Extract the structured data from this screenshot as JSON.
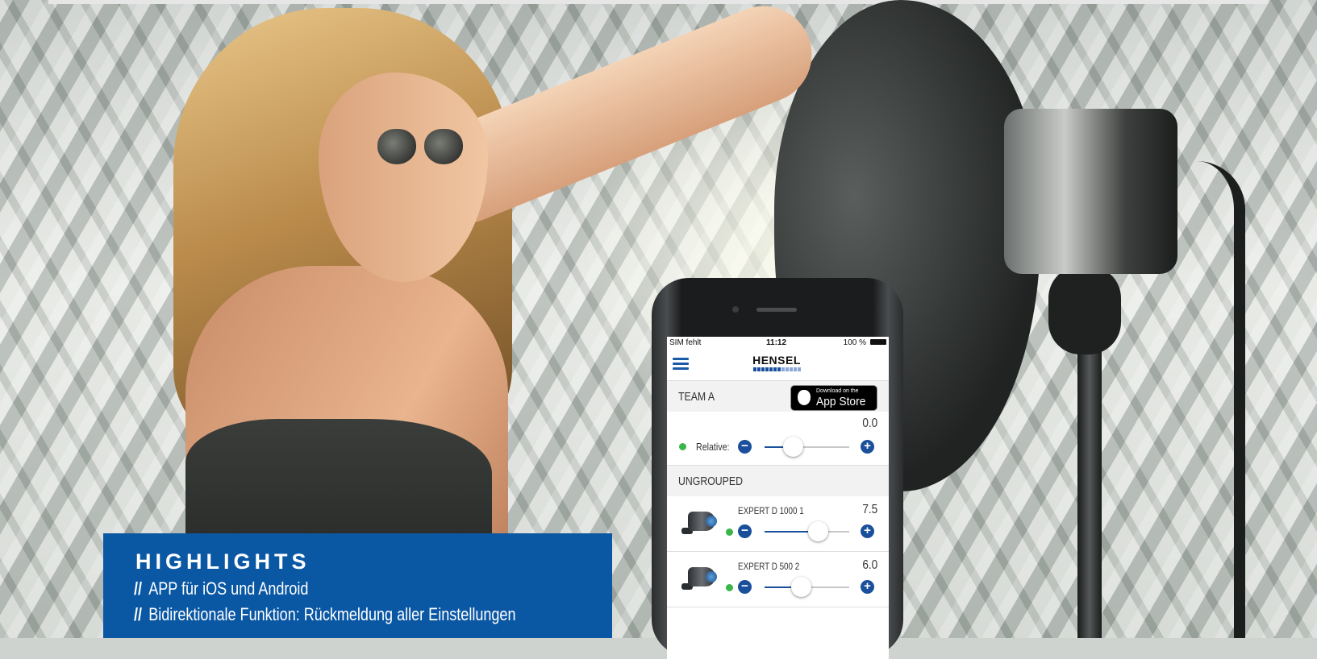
{
  "highlights": {
    "title": "HIGHLIGHTS",
    "items": [
      "APP für iOS und Android",
      "Bidirektionale Funktion: Rückmeldung aller Einstellungen"
    ],
    "bullet": "//",
    "background_color": "#0a57a4"
  },
  "phone": {
    "status_bar": {
      "carrier": "SIM fehlt",
      "time": "11:12",
      "battery": "100 %"
    },
    "header": {
      "brand": "HENSEL",
      "menu_icon": "hamburger-menu-icon"
    },
    "team": {
      "label": "TEAM A",
      "store_badge": {
        "small": "Download on the",
        "big": "App Store",
        "icon": "apple-icon"
      },
      "relative_label": "Relative:",
      "value": "0.0",
      "slider_level": 0.33
    },
    "ungrouped": {
      "label": "UNGROUPED",
      "devices": [
        {
          "name": "EXPERT D 1000 1",
          "value": "7.5",
          "slider_level": 0.63
        },
        {
          "name": "EXPERT D 500 2",
          "value": "6.0",
          "slider_level": 0.43
        }
      ]
    },
    "colors": {
      "accent": "#1a4f9c",
      "online": "#3ab54a"
    }
  }
}
